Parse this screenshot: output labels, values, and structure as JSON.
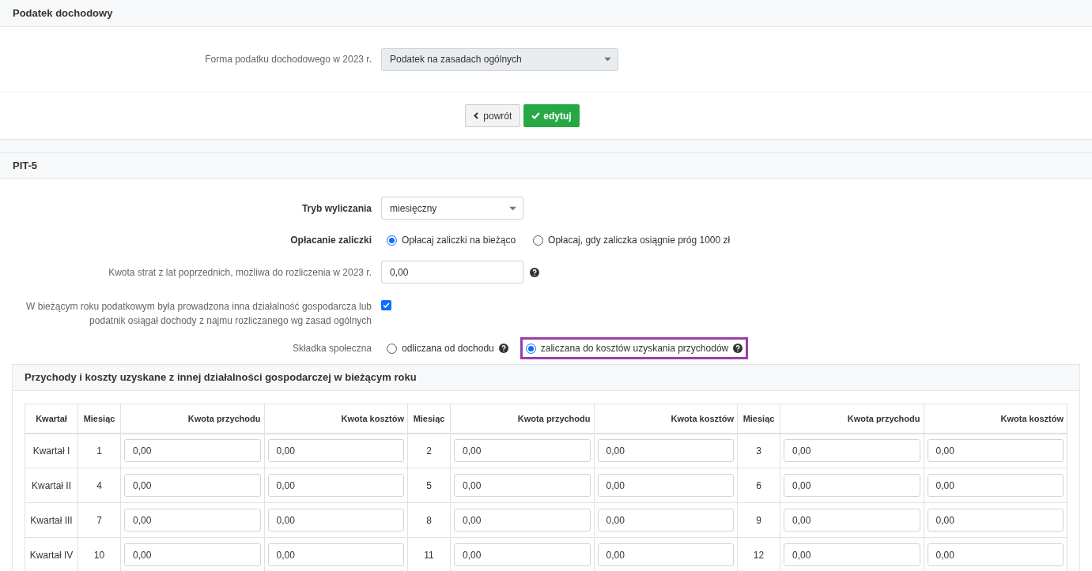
{
  "section1": {
    "title": "Podatek dochodowy",
    "field": {
      "label": "Forma podatku dochodowego w 2023 r.",
      "value": "Podatek na zasadach ogólnych",
      "disabled": true
    }
  },
  "buttons": [
    {
      "kind": "back",
      "label": "powrót"
    },
    {
      "kind": "primary",
      "label": "edytuj"
    }
  ],
  "section2": {
    "title": "PIT-5",
    "tryb": {
      "label": "Tryb wyliczania",
      "value": "miesięczny"
    },
    "zaliczki": {
      "label": "Opłacanie zaliczki",
      "options": [
        {
          "label": "Opłacaj zaliczki na bieżąco",
          "selected": true,
          "help": false,
          "highlighted": false
        },
        {
          "label": "Opłacaj, gdy zaliczka osiągnie próg 1000 zł",
          "selected": false,
          "help": false,
          "highlighted": false
        }
      ]
    },
    "straty": {
      "label": "Kwota strat z lat poprzednich, możliwa do rozliczenia w 2023 r.",
      "value": "0,00"
    },
    "inna": {
      "label": "W bieżącym roku podatkowym była prowadzona inna działalność gospodarcza lub podatnik osiągał dochody z najmu rozliczanego wg zasad ogólnych",
      "checked": true
    },
    "skladka": {
      "label": "Składka społeczna",
      "options": [
        {
          "label": "odliczana od dochodu",
          "selected": false,
          "help": true,
          "highlighted": false
        },
        {
          "label": "zaliczana do kosztów uzyskania przychodów",
          "selected": true,
          "help": true,
          "highlighted": true
        }
      ]
    }
  },
  "panel": {
    "title": "Przychody i koszty uzyskane z innej działalności gospodarczej w bieżącym roku",
    "columns": [
      "Kwartał",
      "Miesiąc",
      "Kwota przychodu",
      "Kwota kosztów",
      "Miesiąc",
      "Kwota przychodu",
      "Kwota kosztów",
      "Miesiąc",
      "Kwota przychodu",
      "Kwota kosztów"
    ],
    "rows": [
      {
        "quarter": "Kwartał I",
        "months": [
          {
            "month": "1",
            "income": "0,00",
            "costs": "0,00"
          },
          {
            "month": "2",
            "income": "0,00",
            "costs": "0,00"
          },
          {
            "month": "3",
            "income": "0,00",
            "costs": "0,00"
          }
        ]
      },
      {
        "quarter": "Kwartał II",
        "months": [
          {
            "month": "4",
            "income": "0,00",
            "costs": "0,00"
          },
          {
            "month": "5",
            "income": "0,00",
            "costs": "0,00"
          },
          {
            "month": "6",
            "income": "0,00",
            "costs": "0,00"
          }
        ]
      },
      {
        "quarter": "Kwartał III",
        "months": [
          {
            "month": "7",
            "income": "0,00",
            "costs": "0,00"
          },
          {
            "month": "8",
            "income": "0,00",
            "costs": "0,00"
          },
          {
            "month": "9",
            "income": "0,00",
            "costs": "0,00"
          }
        ]
      },
      {
        "quarter": "Kwartał IV",
        "months": [
          {
            "month": "10",
            "income": "0,00",
            "costs": "0,00"
          },
          {
            "month": "11",
            "income": "0,00",
            "costs": "0,00"
          },
          {
            "month": "12",
            "income": "0,00",
            "costs": "0,00"
          }
        ]
      }
    ]
  }
}
